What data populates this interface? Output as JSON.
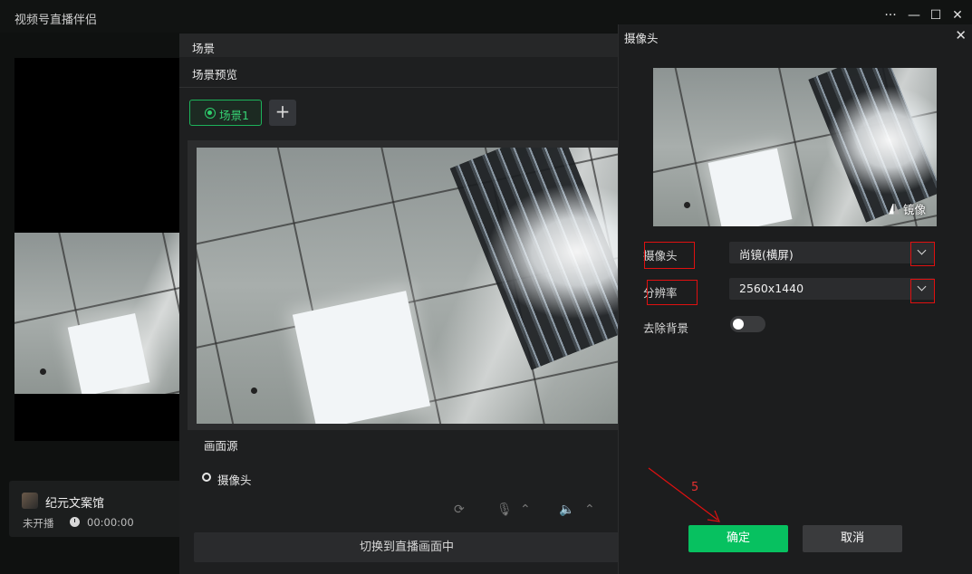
{
  "app": {
    "title": "视频号直播伴侣",
    "more_label": "···",
    "min_label": "—",
    "max_label": "☐",
    "close_label": "✕"
  },
  "channel": {
    "name": "纪元文案馆",
    "status": "未开播",
    "timer": "00:00:00"
  },
  "scene_dialog": {
    "title": "场景",
    "subtitle": "场景预览",
    "tab_label": "场景1",
    "add_label": "+",
    "sources_title": "画面源",
    "source_item": "摄像头",
    "switch_button": "切换到直播画面中"
  },
  "camera_dialog": {
    "title": "摄像头",
    "close_label": "✕",
    "mirror_label": "镜像",
    "camera_label": "摄像头",
    "camera_value": "尚镜(横屏)",
    "resolution_label": "分辨率",
    "resolution_value": "2560x1440",
    "remove_bg_label": "去除背景",
    "remove_bg_on": false,
    "ok_label": "确定",
    "cancel_label": "取消"
  },
  "annotation": {
    "step": "5",
    "color": "#e01010"
  },
  "colors": {
    "accent": "#07c160",
    "scene_tab": "#1db35a"
  }
}
